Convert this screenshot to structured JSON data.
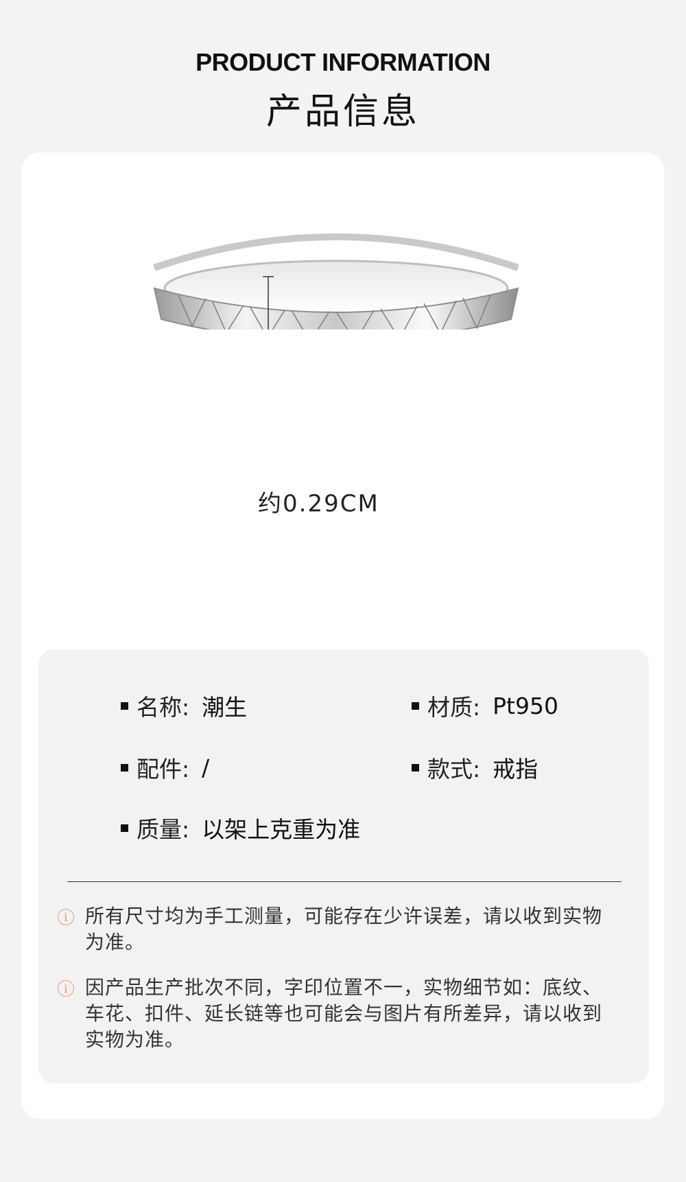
{
  "header": {
    "title_en": "PRODUCT INFORMATION",
    "title_cn": "产品信息"
  },
  "product_image": {
    "dimension_label": "约0.29CM"
  },
  "specs": {
    "name": {
      "label": "名称:",
      "value": "潮生"
    },
    "material": {
      "label": "材质:",
      "value": "Pt950"
    },
    "accessory": {
      "label": "配件:",
      "value": "/"
    },
    "style": {
      "label": "款式:",
      "value": "戒指"
    },
    "weight": {
      "label": "质量:",
      "value": "以架上克重为准"
    }
  },
  "notes": [
    "所有尺寸均为手工测量，可能存在少许误差，请以收到实物为准。",
    "因产品生产批次不同，字印位置不一，实物细节如：底纹、车花、扣件、延长链等也可能会与图片有所差异，请以收到实物为准。"
  ],
  "colors": {
    "page_bg": "#f3f3f3",
    "card_bg": "#ffffff",
    "info_bg": "#f2f2f2",
    "note_icon": "#e8987a"
  },
  "icons": {
    "bullet": "square-bullet-icon",
    "note": "info-circle-icon"
  }
}
